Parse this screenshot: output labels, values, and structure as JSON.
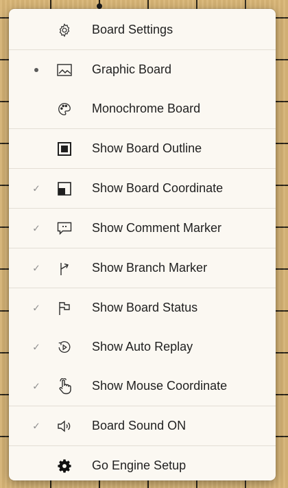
{
  "menu": {
    "items": [
      {
        "label": "Board Settings",
        "icon": "gear-icon",
        "mark": ""
      },
      {
        "label": "Graphic Board",
        "icon": "image-icon",
        "mark": "dot"
      },
      {
        "label": "Monochrome Board",
        "icon": "palette-icon",
        "mark": ""
      },
      {
        "label": "Show Board Outline",
        "icon": "outline-square-icon",
        "mark": ""
      },
      {
        "label": "Show Board Coordinate",
        "icon": "coordinate-square-icon",
        "mark": "check"
      },
      {
        "label": "Show Comment Marker",
        "icon": "comment-icon",
        "mark": "check"
      },
      {
        "label": "Show Branch Marker",
        "icon": "branch-arrow-icon",
        "mark": "check"
      },
      {
        "label": "Show Board Status",
        "icon": "flag-icon",
        "mark": "check"
      },
      {
        "label": "Show Auto Replay",
        "icon": "replay-icon",
        "mark": "check"
      },
      {
        "label": "Show Mouse Coordinate",
        "icon": "touch-icon",
        "mark": "check"
      },
      {
        "label": "Board Sound ON",
        "icon": "speaker-icon",
        "mark": "check"
      },
      {
        "label": "Go Engine Setup",
        "icon": "gear-filled-icon",
        "mark": ""
      }
    ],
    "check_glyph": "✓"
  },
  "colors": {
    "menu_bg": "#fbf8f2",
    "board": "#d9b677",
    "text": "#1f1f1f",
    "check": "#8f8f8f"
  }
}
